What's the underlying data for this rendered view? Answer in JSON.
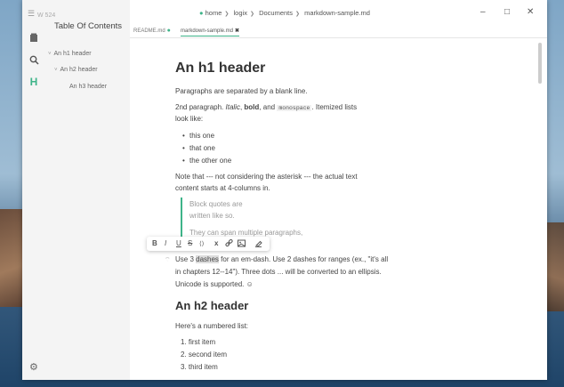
{
  "sidebar": {
    "word_count": "W 524",
    "toc_title": "Table Of Contents",
    "toc_items": [
      "An h1 header",
      "An h2 header",
      "An h3 header"
    ],
    "outline_letter": "H"
  },
  "titlebar": {
    "path": [
      "home",
      "logix",
      "Documents",
      "markdown-sample.md"
    ],
    "minimize": "–",
    "maximize": "□",
    "close": "✕"
  },
  "tabs": [
    {
      "label": "README.md"
    },
    {
      "label": "markdown-sample.md"
    }
  ],
  "format_toolbar": [
    "B",
    "I",
    "U",
    "S",
    "⟨⟩",
    "x",
    "🔗",
    "▣",
    "⊘"
  ],
  "document": {
    "h1": "An h1 header",
    "p1": "Paragraphs are separated by a blank line.",
    "p2_a": "2nd paragraph. ",
    "p2_italic": "Italic",
    "p2_b": ", ",
    "p2_bold": "bold",
    "p2_c": ", and ",
    "p2_mono": "monospace",
    "p2_d": ". Itemized lists",
    "p2_line2": "look like:",
    "bullets": [
      "this one",
      "that one",
      "the other one"
    ],
    "p3_line1": "Note that --- not considering the asterisk --- the actual text",
    "p3_line2": "content starts at 4-columns in.",
    "quote_lines": [
      "Block quotes are",
      "written like so.",
      "They can span multiple paragraphs,"
    ],
    "p4_a": "Use 3 ",
    "p4_highlight": "dashes",
    "p4_b": " for an em-dash. Use 2 dashes for ranges (ex., \"it's all",
    "p4_line2": "in chapters 12--14\"). Three dots ... will be converted to an ellipsis.",
    "p4_line3": "Unicode is supported. ☺",
    "h2": "An h2 header",
    "p5": "Here's a numbered list:",
    "numbered": [
      "1. first item",
      "2. second item",
      "3. third item"
    ]
  }
}
